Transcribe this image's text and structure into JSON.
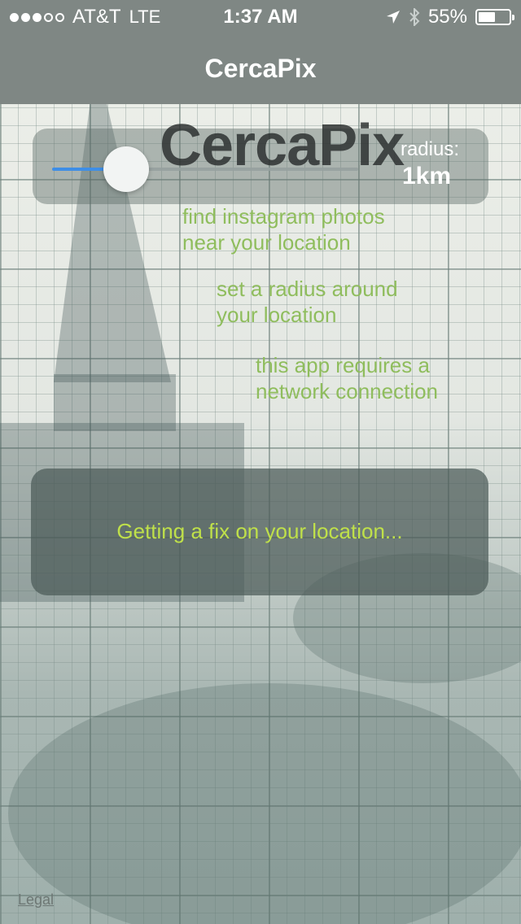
{
  "status": {
    "carrier": "AT&T",
    "network": "LTE",
    "time": "1:37 AM",
    "battery_percent": "55%",
    "battery_level": 0.55,
    "signal_bars": 3,
    "signal_total": 5
  },
  "nav": {
    "title": "CercaPix"
  },
  "radius": {
    "label": "radius:",
    "value": "1km",
    "slider_fraction": 0.18
  },
  "logo_title": "CercaPix",
  "hints": [
    {
      "line1": "find instagram photos",
      "line2": "near your location"
    },
    {
      "line1": "set a radius around",
      "line2": "your location"
    },
    {
      "line1": "this app requires a",
      "line2": "network connection"
    }
  ],
  "loading": {
    "text": "Getting a fix on your location..."
  },
  "footer": {
    "legal": "Legal"
  },
  "colors": {
    "accent": "#3e8ee6",
    "hint_green": "#8fbd5d",
    "loading_yellow": "#bfe04a",
    "bar_gray": "#7f8784"
  },
  "icons": [
    "location-arrow-icon",
    "bluetooth-icon",
    "battery-icon",
    "signal-dot-icon"
  ]
}
